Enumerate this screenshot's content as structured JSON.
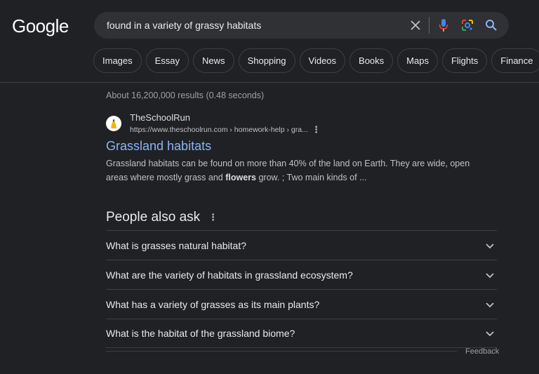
{
  "logo": {
    "text": "Google"
  },
  "search": {
    "query": "found in a variety of grassy habitats",
    "icons": [
      "clear-icon",
      "microphone-icon",
      "lens-icon",
      "search-icon"
    ]
  },
  "tabs": [
    {
      "label": "Images"
    },
    {
      "label": "Essay"
    },
    {
      "label": "News"
    },
    {
      "label": "Shopping"
    },
    {
      "label": "Videos"
    },
    {
      "label": "Books"
    },
    {
      "label": "Maps"
    },
    {
      "label": "Flights"
    },
    {
      "label": "Finance"
    }
  ],
  "stats": "About 16,200,000 results (0.48 seconds)",
  "result": {
    "site_name": "TheSchoolRun",
    "url": "https://www.theschoolrun.com › homework-help › gra...",
    "title": "Grassland habitats",
    "snippet_part1": "Grassland habitats can be found on more than 40% of the land on Earth. They are wide, open areas where mostly grass and ",
    "snippet_bold": "flowers",
    "snippet_part2": " grow. ; Two main kinds of ...",
    "favicon": "pencil-favicon-icon"
  },
  "people_also_ask": {
    "title": "People also ask",
    "questions": [
      "What is grasses natural habitat?",
      "What are the variety of habitats in grassland ecosystem?",
      "What has a variety of grasses as its main plants?",
      "What is the habitat of the grassland biome?"
    ]
  },
  "feedback": "Feedback",
  "colors": {
    "background": "#202124",
    "link": "#8ab4f8",
    "searchbox": "#303134",
    "mic_blue": "#4285f4"
  }
}
